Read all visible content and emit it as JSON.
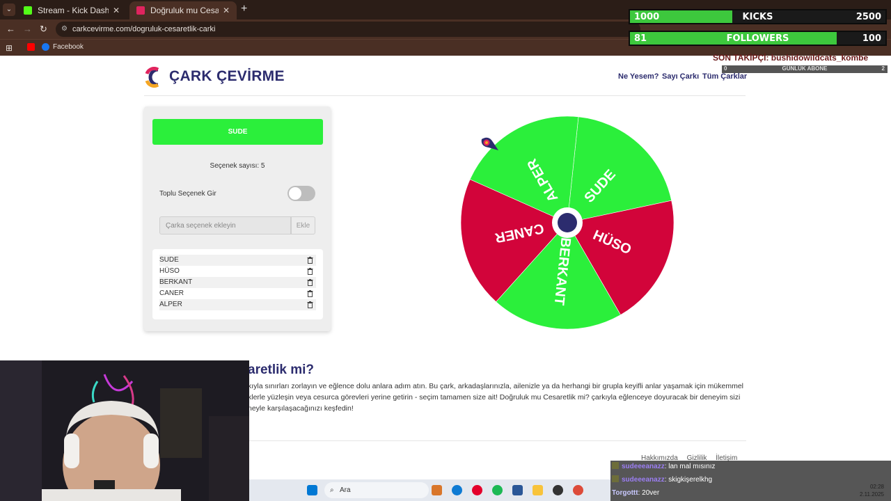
{
  "browser": {
    "tabs": [
      {
        "title": "Stream - Kick Dashboard",
        "active": false,
        "favicon_color": "#53fc18"
      },
      {
        "title": "Doğruluk mu Cesaretlik mi? - Ç",
        "active": true,
        "favicon_color": "#e0245e"
      }
    ],
    "url": "carkcevirme.com/dogruluk-cesaretlik-carki",
    "bookmarks": [
      {
        "label": "",
        "icon": "youtube-icon"
      },
      {
        "label": "Facebook",
        "icon": "facebook-icon"
      }
    ]
  },
  "overlay": {
    "kicks": {
      "current": "1000",
      "label": "KICKS",
      "goal": "2500",
      "progress": 0.4
    },
    "followers": {
      "current": "81",
      "label": "FOLLOWERS",
      "goal": "100",
      "progress": 0.81
    },
    "last_follower": "SON TAKİPÇİ: bushidowildcats_kombe",
    "daily": {
      "left": "0",
      "label": "GÜNLÜK ABONE",
      "right": "2"
    }
  },
  "site": {
    "logo_text": "ÇARK ÇEVİRME",
    "nav": [
      "Ne Yesem?",
      "Sayı Çarkı",
      "Tüm Çarklar"
    ]
  },
  "panel": {
    "result": "SUDE",
    "option_count": "Seçenek sayısı: 5",
    "bulk_label": "Toplu Seçenek Gir",
    "bulk_enabled": false,
    "input_placeholder": "Çarka seçenek ekleyin",
    "add_label": "Ekle",
    "items": [
      "SUDE",
      "HÜSO",
      "BERKANT",
      "CANER",
      "ALPER"
    ]
  },
  "wheel": {
    "colors": {
      "green": "#2bef3b",
      "red": "#d2043a",
      "center": "#2c2c6e"
    },
    "segments": [
      {
        "label": "SUDE",
        "color": "green"
      },
      {
        "label": "HÜSO",
        "color": "red"
      },
      {
        "label": "BERKANT",
        "color": "green"
      },
      {
        "label": "CANER",
        "color": "red"
      },
      {
        "label": "ALPER",
        "color": "green"
      }
    ]
  },
  "article": {
    "title": "aretlik mi?",
    "lines": [
      "kıyla sınırları zorlayın ve eğlence dolu anlara adım atın. Bu çark, arkadaşlarınızla, ailenizle ya da herhangi bir grupla keyifli anlar yaşamak için mükemmel",
      "klerle yüzleşin veya cesurca görevleri yerine getirin - seçim tamamen size ait! Doğruluk mu Cesaretlik mi? çarkıyla eğlenceye doyuracak bir deneyim sizi",
      "neyle karşılaşacağınızı keşfedin!"
    ]
  },
  "footer": [
    "Hakkımızda",
    "Gizlilik",
    "İletişim"
  ],
  "chat": [
    {
      "user": "sudeeeanazz",
      "message": ": lan mal mısınız"
    },
    {
      "user": "sudeeeanazz",
      "message": ": skigkişerelkhg"
    },
    {
      "user": "Torgottt",
      "message": ": 20ver"
    }
  ],
  "taskbar": {
    "search_label": "Ara",
    "time": "02:28",
    "date": "2.11.2025"
  }
}
